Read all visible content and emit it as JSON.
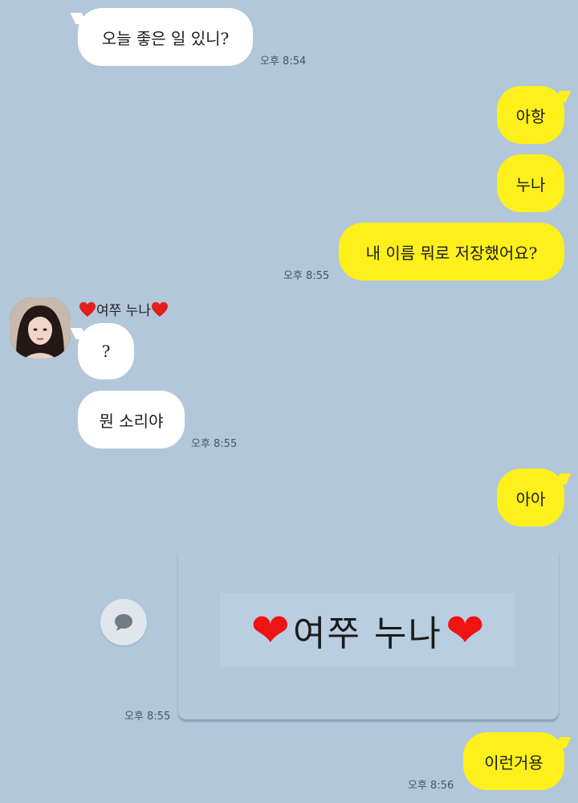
{
  "chat": {
    "msg1": {
      "text": "오늘 좋은 일 있니?",
      "time": "오후 8:54"
    },
    "msg2": {
      "text": "아항"
    },
    "msg3": {
      "text": "누나"
    },
    "msg4": {
      "text": "내 이름 뭐로 저장했어요?",
      "time": "오후 8:55"
    },
    "sender": {
      "name": "여쭈 누나"
    },
    "msg5": {
      "text": "?"
    },
    "msg6": {
      "text": "뭔 소리야",
      "time": "오후 8:55"
    },
    "msg7": {
      "text": "아아"
    },
    "image_msg": {
      "caption": "여쭈 누나",
      "time": "오후 8:55"
    },
    "msg8": {
      "text": "이런거용",
      "time": "오후 8:56"
    }
  },
  "colors": {
    "background": "#b2c7da",
    "incoming_bubble": "#ffffff",
    "outgoing_bubble": "#fef01b",
    "heart": "#e0201c"
  },
  "icons": {
    "share": "speech-bubble-icon",
    "heart": "heart-icon"
  }
}
